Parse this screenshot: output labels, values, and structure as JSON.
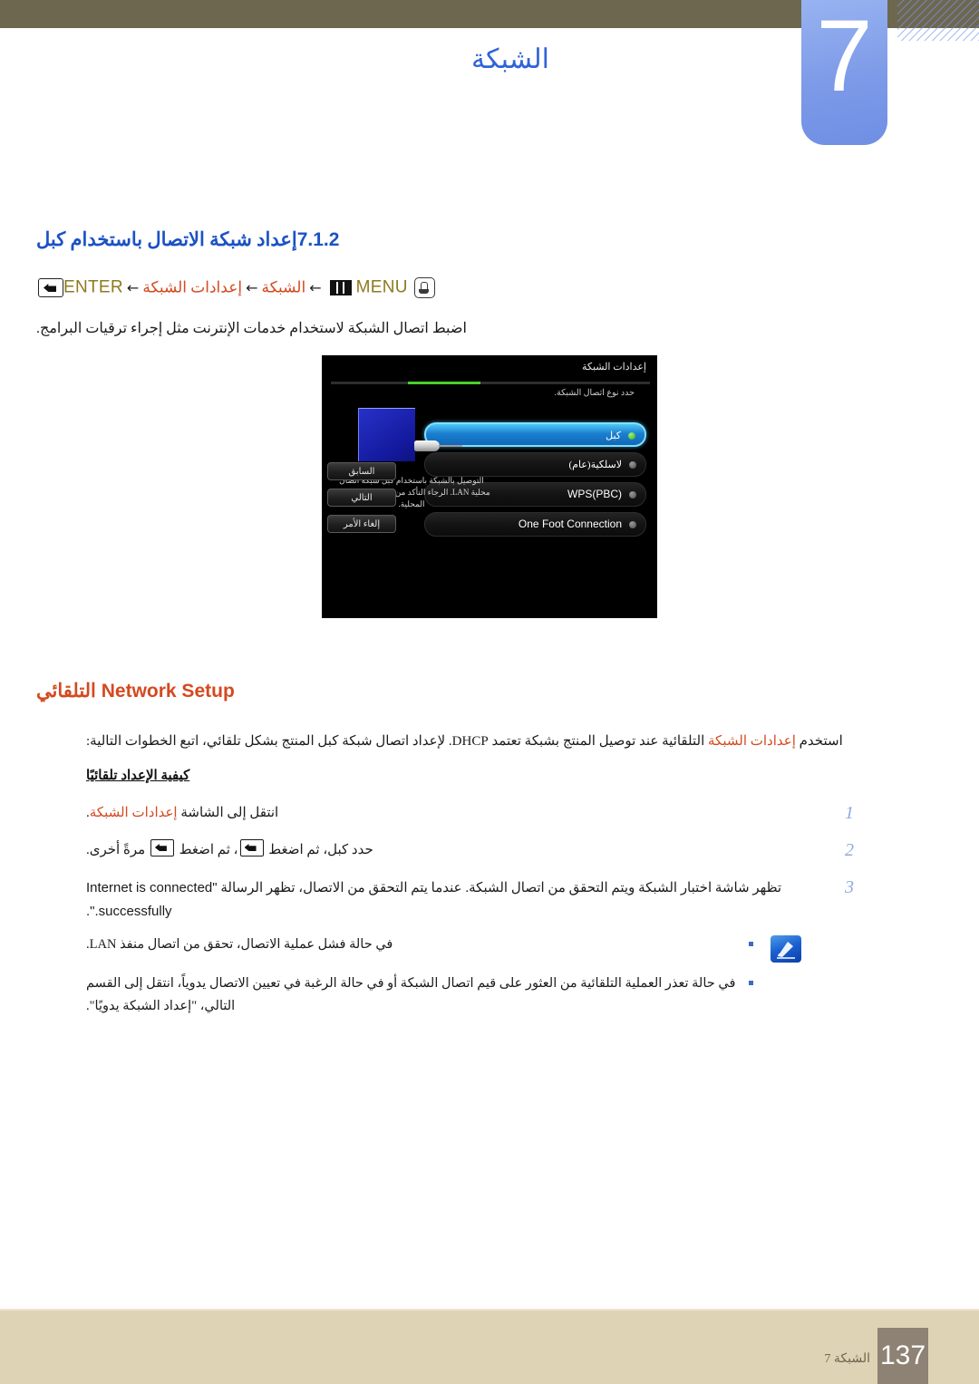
{
  "header": {
    "chapter_number": "7",
    "chapter_title": "الشبكة",
    "accent_blue": "#7d9ae8",
    "bar_color": "#6e6750"
  },
  "section": {
    "number": "7.1.2",
    "title": "إعداد شبكة الاتصال باستخدام كبل",
    "color": "#1b52c4"
  },
  "menu_path": {
    "hand_icon": "hand-press-icon",
    "menu_label": "MENU",
    "menu_icon": "three-bars-icon",
    "arrow": "←",
    "item_1": "الشبكة",
    "item_2": "إعدادات الشبكة",
    "enter_icon": "enter-key-icon",
    "enter_label": "ENTER",
    "accent": "#d4491f",
    "key_color": "#8d7a1e"
  },
  "intro": "اضبط اتصال الشبكة لاستخدام خدمات الإنترنت مثل إجراء ترقيات البرامج.",
  "osd": {
    "title": "إعدادات الشبكة",
    "subtitle": "حدد نوع اتصال الشبكة.",
    "progress_color": "#49d12a",
    "options": [
      {
        "label": "كبل",
        "selected": true,
        "lang": "ar"
      },
      {
        "label": "لاسلكية(عام)",
        "selected": false,
        "lang": "ar"
      },
      {
        "label": "WPS(PBC)",
        "selected": false,
        "lang": "en"
      },
      {
        "label": "One Foot Connection",
        "selected": false,
        "lang": "en"
      }
    ],
    "description": "التوصيل بالشبكة باستخدام كبل شبكة اتصال محلية LAN. الرجاء التأكد من اتصال كبل الشبكة المحلية.",
    "buttons": [
      "السابق",
      "التالي",
      "إلغاء الأمر"
    ],
    "device_icon": "network-device-icon",
    "plug_icon": "lan-plug-icon"
  },
  "auto_setup": {
    "heading_en": "Network Setup",
    "heading_ar": "التلقائي",
    "paragraph_prefix": "استخدم ",
    "paragraph_highlight": "إعدادات الشبكة",
    "paragraph_rest": " التلقائية عند توصيل المنتج بشبكة تعتمد DHCP. لإعداد اتصال شبكة كبل المنتج بشكل تلقائي، اتبع الخطوات التالية:",
    "how_to": "كيفية الإعداد تلقائيًا"
  },
  "steps": [
    {
      "number": "1",
      "prefix": "انتقل إلى الشاشة ",
      "highlight": "إعدادات الشبكة",
      "suffix": "."
    },
    {
      "number": "2",
      "part_a": "حدد كبل، ثم اضغط ",
      "part_b": "، ثم اضغط ",
      "part_c": " مرةً أخرى."
    },
    {
      "number": "3",
      "part_a": "تظهر شاشة اختبار الشبكة ويتم التحقق من اتصال الشبكة. عندما يتم التحقق من الاتصال، تظهر الرسالة ",
      "message": "\"Internet is connected successfully.\"."
    }
  ],
  "notes": {
    "icon": "note-pencil-icon",
    "items": [
      "في حالة فشل عملية الاتصال، تحقق من اتصال منفذ LAN.",
      "في حالة تعذر العملية التلقائية من العثور على قيم اتصال الشبكة أو في حالة الرغبة في تعيين الاتصال يدوياً، انتقل إلى القسم التالي، \"إعداد الشبكة يدويًا\"."
    ]
  },
  "footer": {
    "page_number": "137",
    "label": "الشبكة 7",
    "bar_color": "#ded3b4",
    "page_box_color": "#8d8274"
  }
}
